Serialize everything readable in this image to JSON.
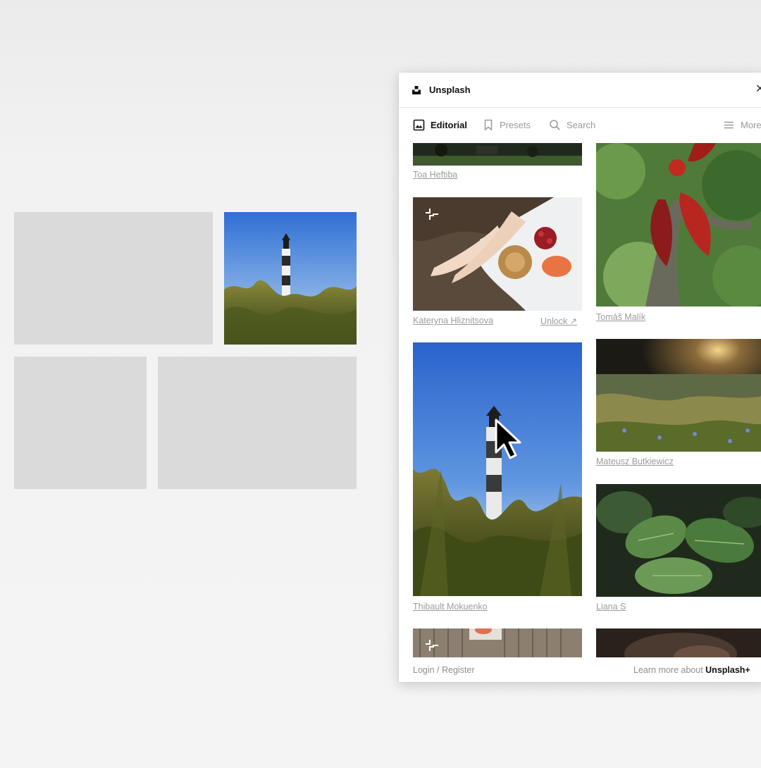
{
  "panel": {
    "title": "Unsplash",
    "close_icon": "close-icon",
    "tabs": [
      {
        "label": "Editorial",
        "icon": "image-icon",
        "active": true
      },
      {
        "label": "Presets",
        "icon": "bookmark-icon",
        "active": false
      },
      {
        "label": "Search",
        "icon": "search-icon",
        "active": false
      },
      {
        "label": "More",
        "icon": "menu-icon",
        "active": false
      }
    ],
    "photos": {
      "toa": {
        "credit": "Toa Heftiba"
      },
      "kateryna": {
        "credit": "Kateryna Hliznitsova",
        "unlock": "Unlock ↗"
      },
      "tomas": {
        "credit": "Tomáš Malík"
      },
      "thibault": {
        "credit": "Thibault Mokuenko"
      },
      "mateusz": {
        "credit": "Mateusz Butkiewicz"
      },
      "liana": {
        "credit": "Liana S"
      }
    },
    "footer": {
      "login": "Login / Register",
      "learn_prefix": "Learn more about ",
      "learn_brand": "Unsplash+"
    }
  },
  "colors": {
    "placeholder": "#dadadb",
    "sky": "#3d7ad8",
    "accent_text": "#111111",
    "muted_text": "#9c9c9c"
  }
}
